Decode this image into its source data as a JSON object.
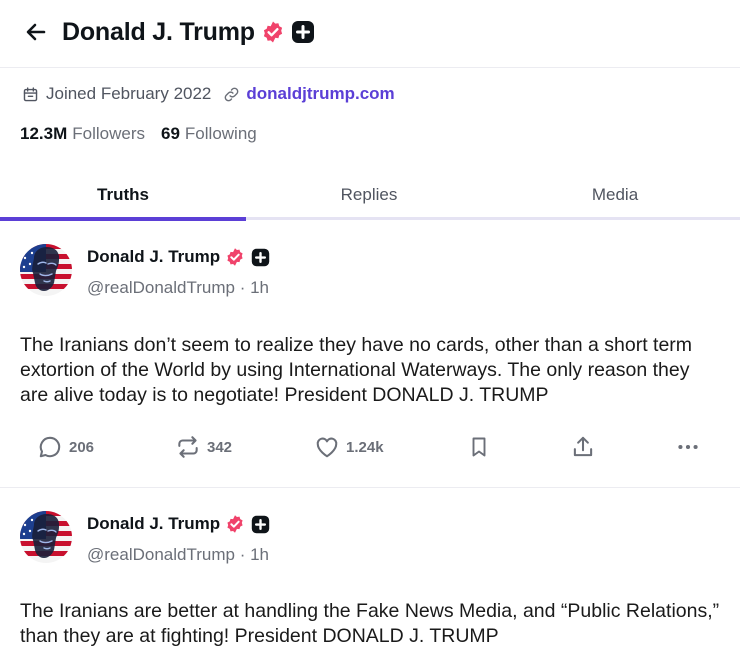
{
  "profile": {
    "name": "Donald J. Trump",
    "joined": "Joined February 2022",
    "website": "donaldjtrump.com",
    "followers_count": "12.3M",
    "followers_label": "Followers",
    "following_count": "69",
    "following_label": "Following"
  },
  "tabs": [
    {
      "label": "Truths",
      "active": true
    },
    {
      "label": "Replies",
      "active": false
    },
    {
      "label": "Media",
      "active": false
    }
  ],
  "posts": [
    {
      "author": "Donald J. Trump",
      "handle": "@realDonaldTrump",
      "time": "1h",
      "text": "The Iranians don’t seem to realize they have no cards, other than a short term extortion of the World by using International Waterways. The only reason they are alive today is to negotiate! President DONALD J. TRUMP",
      "replies": "206",
      "retruths": "342",
      "likes": "1.24k"
    },
    {
      "author": "Donald J. Trump",
      "handle": "@realDonaldTrump",
      "time": "1h",
      "text": "The Iranians are better at handling the Fake News Media, and “Public Relations,” than they are at fighting! President DONALD J. TRUMP"
    }
  ],
  "colors": {
    "accent": "#5b3fd6",
    "verified": "#f0436b",
    "icon": "#6b6f78"
  },
  "icons": [
    "arrow-left-icon",
    "verified-badge-icon",
    "plus-badge-icon",
    "calendar-icon",
    "link-icon",
    "reply-icon",
    "retruth-icon",
    "heart-icon",
    "bookmark-icon",
    "share-icon",
    "more-icon"
  ]
}
